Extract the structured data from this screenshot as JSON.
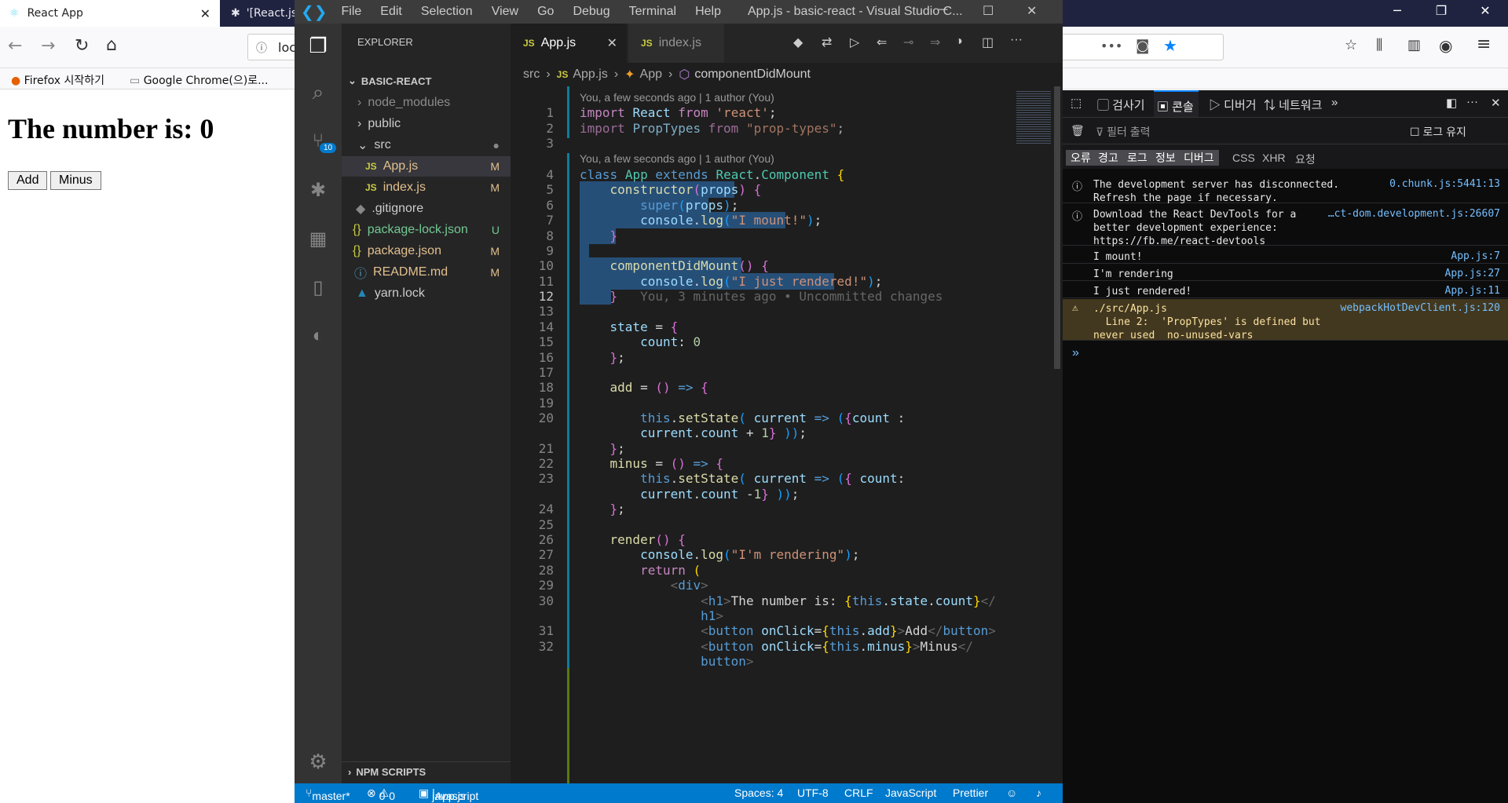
{
  "firefox": {
    "tab_active": "React App",
    "tab_inactive": "'[React.js",
    "url_fragment": "loc",
    "bookmark1": "Firefox 시작하기",
    "bookmark2": "Google Chrome(으)로...",
    "win_min": "─",
    "win_max": "❐",
    "win_close": "✕"
  },
  "page": {
    "heading": "The number is: 0",
    "add": "Add",
    "minus": "Minus"
  },
  "vscode": {
    "title": "App.js - basic-react - Visual Studio C...",
    "menu": [
      "File",
      "Edit",
      "Selection",
      "View",
      "Go",
      "Debug",
      "Terminal",
      "Help"
    ],
    "scm_badge": "10",
    "explorer_label": "EXPLORER",
    "project": "BASIC-REACT",
    "npm": "NPM SCRIPTS",
    "tree": [
      {
        "name": "node_modules",
        "status": ""
      },
      {
        "name": "public",
        "status": ""
      },
      {
        "name": "src",
        "status": "●"
      },
      {
        "name": "App.js",
        "status": "M"
      },
      {
        "name": "index.js",
        "status": "M"
      },
      {
        "name": ".gitignore",
        "status": ""
      },
      {
        "name": "package-lock.json",
        "status": "U"
      },
      {
        "name": "package.json",
        "status": "M"
      },
      {
        "name": "README.md",
        "status": "M"
      },
      {
        "name": "yarn.lock",
        "status": ""
      }
    ],
    "tabs": [
      "App.js",
      "index.js"
    ],
    "breadcrumb": [
      "src",
      "App.js",
      "App",
      "componentDidMount"
    ],
    "lens1": "You, a few seconds ago | 1 author (You)",
    "lens2": "You, a few seconds ago | 1 author (You)",
    "blame": "You, 3 minutes ago • Uncommitted changes",
    "status": {
      "branch": "master*",
      "errors": "0",
      "warnings": "0",
      "lang_ctx": "javascript",
      "file": "App.js",
      "spaces": "Spaces: 4",
      "enc": "UTF-8",
      "eol": "CRLF",
      "mode": "JavaScript",
      "prettier": "Prettier"
    }
  },
  "devtools": {
    "tabs": [
      "검사기",
      "콘솔",
      "디버거",
      "네트워크"
    ],
    "filter": "필터 출력",
    "persist": "로그 유지",
    "levels": [
      "오류",
      "경고",
      "로그",
      "정보",
      "디버그"
    ],
    "extra": [
      "CSS",
      "XHR",
      "요청"
    ],
    "messages": [
      {
        "text": "The development server has disconnected.\nRefresh the page if necessary.",
        "src": "0.chunk.js:5441:13"
      },
      {
        "text": "Download the React DevTools for a\nbetter development experience:\nhttps://fb.me/react-devtools",
        "src": "…ct-dom.development.js:26607"
      },
      {
        "text": "I mount!",
        "src": "App.js:7"
      },
      {
        "text": "I'm rendering",
        "src": "App.js:27"
      },
      {
        "text": "I just rendered!",
        "src": "App.js:11"
      },
      {
        "text": "./src/App.js\n  Line 2:  'PropTypes' is defined but\nnever used  no-unused-vars",
        "src": "webpackHotDevClient.js:120"
      }
    ],
    "prompt": "»"
  }
}
